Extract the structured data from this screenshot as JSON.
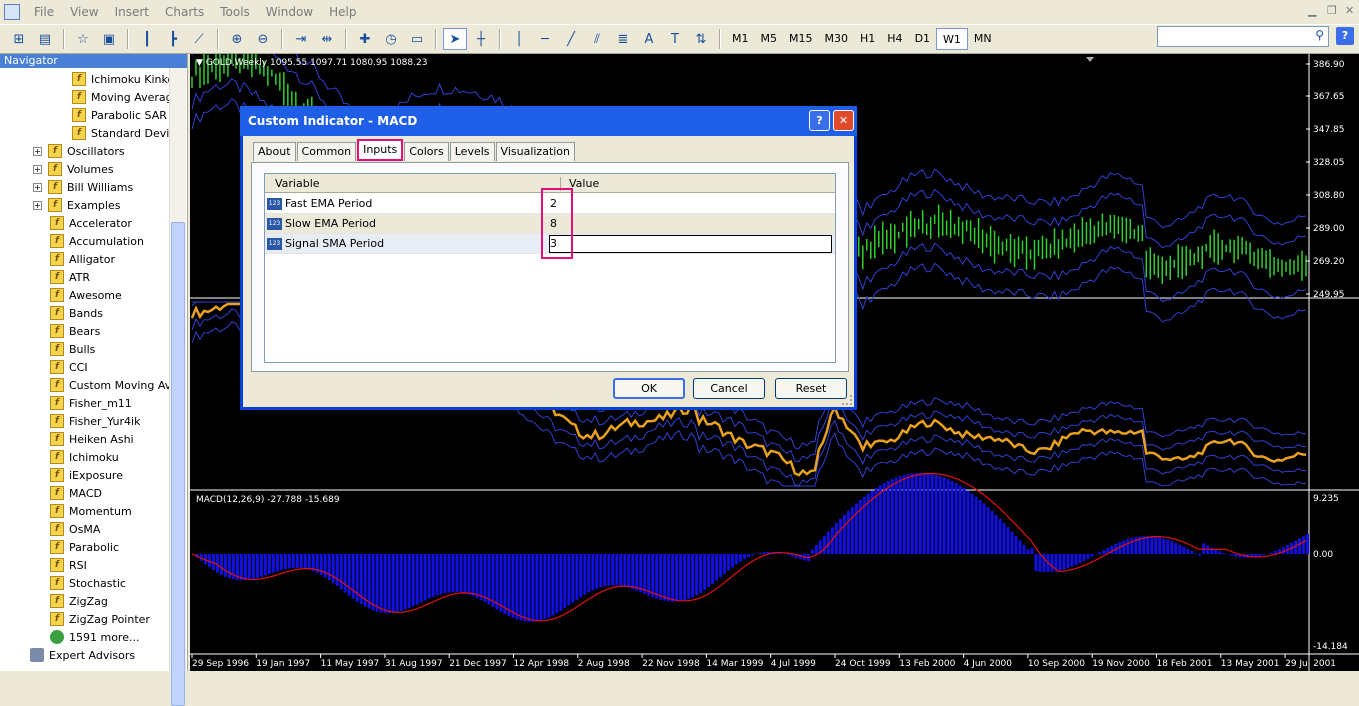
{
  "menubar": {
    "items": [
      "File",
      "View",
      "Insert",
      "Charts",
      "Tools",
      "Window",
      "Help"
    ]
  },
  "toolbar": {
    "timeframes": [
      "M1",
      "M5",
      "M15",
      "M30",
      "H1",
      "H4",
      "D1",
      "W1",
      "MN"
    ],
    "active_timeframe": "W1",
    "text_tool": "A",
    "label_tool": "T"
  },
  "search": {
    "value": ""
  },
  "navigator": {
    "title": "Navigator",
    "items": [
      {
        "label": "Ichimoku Kinko",
        "type": "fx",
        "indent": 3
      },
      {
        "label": "Moving Averag",
        "type": "fx",
        "indent": 3
      },
      {
        "label": "Parabolic SAR",
        "type": "fx",
        "indent": 3
      },
      {
        "label": "Standard Devia",
        "type": "fx",
        "indent": 3
      },
      {
        "label": "Oscillators",
        "type": "folder",
        "indent": 2
      },
      {
        "label": "Volumes",
        "type": "folder",
        "indent": 2
      },
      {
        "label": "Bill Williams",
        "type": "folder",
        "indent": 2
      },
      {
        "label": "Examples",
        "type": "folder",
        "indent": 2
      },
      {
        "label": "Accelerator",
        "type": "fx",
        "indent": 2
      },
      {
        "label": "Accumulation",
        "type": "fx",
        "indent": 2
      },
      {
        "label": "Alligator",
        "type": "fx",
        "indent": 2
      },
      {
        "label": "ATR",
        "type": "fx",
        "indent": 2
      },
      {
        "label": "Awesome",
        "type": "fx",
        "indent": 2
      },
      {
        "label": "Bands",
        "type": "fx",
        "indent": 2
      },
      {
        "label": "Bears",
        "type": "fx",
        "indent": 2
      },
      {
        "label": "Bulls",
        "type": "fx",
        "indent": 2
      },
      {
        "label": "CCI",
        "type": "fx",
        "indent": 2
      },
      {
        "label": "Custom Moving Ave",
        "type": "fx",
        "indent": 2
      },
      {
        "label": "Fisher_m11",
        "type": "fx",
        "indent": 2
      },
      {
        "label": "Fisher_Yur4ik",
        "type": "fx",
        "indent": 2
      },
      {
        "label": "Heiken Ashi",
        "type": "fx",
        "indent": 2
      },
      {
        "label": "Ichimoku",
        "type": "fx",
        "indent": 2
      },
      {
        "label": "iExposure",
        "type": "fx",
        "indent": 2
      },
      {
        "label": "MACD",
        "type": "fx",
        "indent": 2
      },
      {
        "label": "Momentum",
        "type": "fx",
        "indent": 2
      },
      {
        "label": "OsMA",
        "type": "fx",
        "indent": 2
      },
      {
        "label": "Parabolic",
        "type": "fx",
        "indent": 2
      },
      {
        "label": "RSI",
        "type": "fx",
        "indent": 2
      },
      {
        "label": "Stochastic",
        "type": "fx",
        "indent": 2
      },
      {
        "label": "ZigZag",
        "type": "fx",
        "indent": 2
      },
      {
        "label": "ZigZag Pointer",
        "type": "fx",
        "indent": 2
      },
      {
        "label": "1591 more...",
        "type": "globe",
        "indent": 2
      },
      {
        "label": "Expert Advisors",
        "type": "ea",
        "indent": 1
      }
    ]
  },
  "chart": {
    "header": "GOLD,Weekly  1095.55 1097.71 1080.95 1088.23",
    "macd_header": "MACD(12,26,9) -27.788 -15.689",
    "price_axis": [
      "386.90",
      "367.65",
      "347.85",
      "328.05",
      "308.80",
      "289.00",
      "269.20",
      "249.95"
    ],
    "macd_axis": [
      "9.235",
      "0.00",
      "-14.184"
    ],
    "date_axis": [
      "29 Sep 1996",
      "19 Jan 1997",
      "11 May 1997",
      "31 Aug 1997",
      "21 Dec 1997",
      "12 Apr 1998",
      "2 Aug 1998",
      "22 Nov 1998",
      "14 Mar 1999",
      "4 Jul 1999",
      "24 Oct 1999",
      "13 Feb 2000",
      "4 Jun 2000",
      "10 Sep 2000",
      "19 Nov 2000",
      "18 Feb 2001",
      "13 May 2001",
      "29 Jul 2001"
    ],
    "colors": {
      "bars": "#30d030",
      "bands": "#3040d0",
      "line": "#e8a020",
      "hist": "#1010e0",
      "signal": "#e01010"
    }
  },
  "dialog": {
    "title": "Custom Indicator - MACD",
    "tabs": [
      "About",
      "Common",
      "Inputs",
      "Colors",
      "Levels",
      "Visualization"
    ],
    "selected_tab": "Inputs",
    "columns": {
      "variable": "Variable",
      "value": "Value"
    },
    "rows": [
      {
        "name": "Fast EMA Period",
        "value": "2"
      },
      {
        "name": "Slow EMA Period",
        "value": "8"
      },
      {
        "name": "Signal SMA Period",
        "value": "3"
      }
    ],
    "buttons": {
      "ok": "OK",
      "cancel": "Cancel",
      "reset": "Reset"
    }
  },
  "icons": {
    "param_icon": "123"
  }
}
